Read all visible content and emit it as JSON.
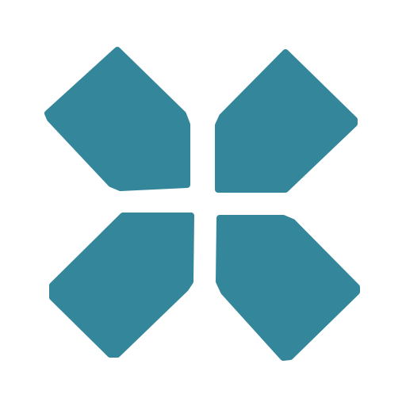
{
  "logo": {
    "icon": "four-petal-cross-icon",
    "color": "#34879B",
    "background": "#FFFFFF"
  }
}
